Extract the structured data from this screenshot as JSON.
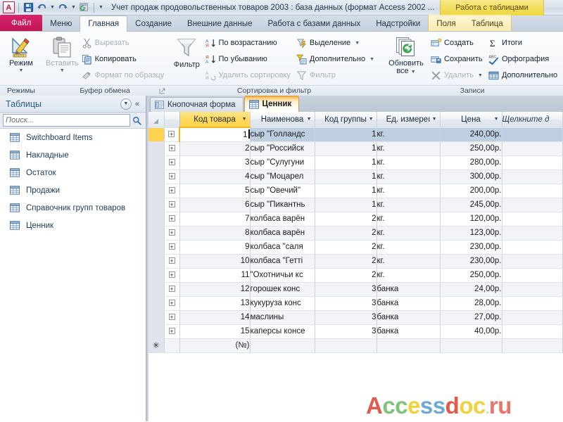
{
  "titlebar": {
    "app_logo": "A",
    "quick_access": [
      {
        "name": "save-icon",
        "label": "Сохранить"
      },
      {
        "name": "undo-icon",
        "label": "Отменить"
      },
      {
        "name": "redo-icon",
        "label": "Вернуть"
      },
      {
        "name": "refresh-all-icon",
        "label": "Обновить все"
      },
      {
        "name": "customize-qat-icon",
        "label": "Настройка панели быстрого доступа"
      }
    ],
    "document_title": "Учет продаж продовольственных товаров 2003 : база данных (формат Access 2002 ...",
    "context_tab_title": "Работа с таблицами"
  },
  "ribbon": {
    "file_tab": "Файл",
    "tabs": [
      {
        "label": "Меню",
        "active": false,
        "contextual": false
      },
      {
        "label": "Главная",
        "active": true,
        "contextual": false
      },
      {
        "label": "Создание",
        "active": false,
        "contextual": false
      },
      {
        "label": "Внешние данные",
        "active": false,
        "contextual": false
      },
      {
        "label": "Работа с базами данных",
        "active": false,
        "contextual": false
      },
      {
        "label": "Надстройки",
        "active": false,
        "contextual": false
      },
      {
        "label": "Поля",
        "active": false,
        "contextual": true
      },
      {
        "label": "Таблица",
        "active": false,
        "contextual": true
      }
    ],
    "groups": [
      {
        "title": "Режимы",
        "big": {
          "label": "Режим",
          "icon": "view-design-icon",
          "has_caret": true,
          "disabled": false
        }
      },
      {
        "title": "Буфер обмена",
        "has_dialog_launcher": true,
        "big": {
          "label": "Вставить",
          "icon": "paste-icon",
          "has_caret": true,
          "disabled": true
        },
        "small": [
          {
            "label": "Вырезать",
            "icon": "cut-icon",
            "disabled": true,
            "caret": false
          },
          {
            "label": "Копировать",
            "icon": "copy-icon",
            "disabled": false,
            "caret": false
          },
          {
            "label": "Формат по образцу",
            "icon": "format-painter-icon",
            "disabled": true,
            "caret": false
          }
        ]
      },
      {
        "title": "Сортировка и фильтр",
        "big": {
          "label": "Фильтр",
          "icon": "filter-icon",
          "has_caret": false,
          "disabled": false
        },
        "small": [
          {
            "label": "По возрастанию",
            "icon": "sort-asc-icon",
            "disabled": false,
            "caret": false
          },
          {
            "label": "По убыванию",
            "icon": "sort-desc-icon",
            "disabled": false,
            "caret": false
          },
          {
            "label": "Удалить сортировку",
            "icon": "clear-sort-icon",
            "disabled": true,
            "caret": false
          }
        ],
        "small2": [
          {
            "label": "Выделение",
            "icon": "selection-icon",
            "disabled": false,
            "caret": true
          },
          {
            "label": "Дополнительно",
            "icon": "advanced-filter-icon",
            "disabled": false,
            "caret": true
          },
          {
            "label": "Фильтр",
            "icon": "toggle-filter-icon",
            "disabled": true,
            "caret": false
          }
        ]
      },
      {
        "title": "Записи",
        "big": {
          "label": "Обновить\nвсе",
          "label_line1": "Обновить",
          "label_line2": "все",
          "icon": "refresh-all-big-icon",
          "has_caret": true,
          "disabled": false
        },
        "small": [
          {
            "label": "Создать",
            "icon": "new-record-icon",
            "disabled": false,
            "caret": false
          },
          {
            "label": "Сохранить",
            "icon": "save-record-icon",
            "disabled": false,
            "caret": false
          },
          {
            "label": "Удалить",
            "icon": "delete-record-icon",
            "disabled": true,
            "caret": true
          }
        ],
        "small2": [
          {
            "label": "Итоги",
            "icon": "totals-icon",
            "disabled": false,
            "caret": false
          },
          {
            "label": "Орфография",
            "icon": "spelling-icon",
            "disabled": false,
            "caret": false
          },
          {
            "label": "Дополнительно",
            "icon": "more-records-icon",
            "disabled": false,
            "caret": false
          }
        ]
      }
    ]
  },
  "navpane": {
    "title": "Таблицы",
    "search_placeholder": "Поиск...",
    "items": [
      {
        "label": "Switchboard Items",
        "icon": "table-icon"
      },
      {
        "label": "Накладные",
        "icon": "table-icon"
      },
      {
        "label": "Остаток",
        "icon": "table-icon"
      },
      {
        "label": "Продажи",
        "icon": "table-icon"
      },
      {
        "label": "Справочник групп товаров",
        "icon": "table-icon"
      },
      {
        "label": "Ценник",
        "icon": "table-icon"
      }
    ]
  },
  "document_tabs": [
    {
      "label": "Кнопочная форма",
      "icon": "form-icon",
      "active": false
    },
    {
      "label": "Ценник",
      "icon": "table-icon",
      "active": true
    }
  ],
  "datasheet": {
    "columns": [
      {
        "label": "Код товара",
        "align": "right",
        "selected": true
      },
      {
        "label": "Наименова",
        "align": "left",
        "selected": false
      },
      {
        "label": "Код группы",
        "align": "right",
        "selected": false
      },
      {
        "label": "Ед. измереı",
        "align": "left",
        "selected": false
      },
      {
        "label": "Цена",
        "align": "right",
        "selected": false
      }
    ],
    "add_new_column_label": "Щелкните д",
    "new_record_placeholder": "(№)",
    "rows": [
      {
        "code": "1",
        "name": "сыр \"Голландс",
        "group": "1",
        "unit": "кг.",
        "price": "240,00р."
      },
      {
        "code": "2",
        "name": "сыр \"Российск",
        "group": "1",
        "unit": "кг.",
        "price": "250,00р."
      },
      {
        "code": "3",
        "name": "сыр \"Сулугуни",
        "group": "1",
        "unit": "кг.",
        "price": "280,00р."
      },
      {
        "code": "4",
        "name": "сыр \"Моцарел",
        "group": "1",
        "unit": "кг.",
        "price": "300,00р."
      },
      {
        "code": "5",
        "name": "сыр \"Овечий\"",
        "group": "1",
        "unit": "кг.",
        "price": "200,00р."
      },
      {
        "code": "6",
        "name": "сыр \"Пикантнь",
        "group": "1",
        "unit": "кг.",
        "price": "245,00р."
      },
      {
        "code": "7",
        "name": "колбаса варён",
        "group": "2",
        "unit": "кг.",
        "price": "120,00р."
      },
      {
        "code": "8",
        "name": "колбаса варён",
        "group": "2",
        "unit": "кг.",
        "price": "123,00р."
      },
      {
        "code": "9",
        "name": "колбаса \"саля",
        "group": "2",
        "unit": "кг.",
        "price": "230,00р."
      },
      {
        "code": "10",
        "name": "колбаса \"Гетті",
        "group": "2",
        "unit": "кг.",
        "price": "230,00р."
      },
      {
        "code": "11",
        "name": "\"Охотничьи кс",
        "group": "2",
        "unit": "кг.",
        "price": "250,00р."
      },
      {
        "code": "12",
        "name": "горошек конс",
        "group": "3",
        "unit": "банка",
        "price": "24,00р."
      },
      {
        "code": "13",
        "name": "кукуруза конс",
        "group": "3",
        "unit": "банка",
        "price": "28,00р."
      },
      {
        "code": "14",
        "name": "маслины",
        "group": "3",
        "unit": "банка",
        "price": "27,00р."
      },
      {
        "code": "15",
        "name": "каперсы консе",
        "group": "3",
        "unit": "банка",
        "price": "40,00р."
      }
    ]
  },
  "watermark": {
    "letters": [
      {
        "ch": "A",
        "color": "#e05a4e"
      },
      {
        "ch": "c",
        "color": "#7cc47a"
      },
      {
        "ch": "c",
        "color": "#7cc47a"
      },
      {
        "ch": "e",
        "color": "#f2d23c"
      },
      {
        "ch": "s",
        "color": "#6aa9d8"
      },
      {
        "ch": "s",
        "color": "#6aa9d8"
      },
      {
        "ch": "d",
        "color": "#e05a4e"
      },
      {
        "ch": "o",
        "color": "#f2d23c"
      },
      {
        "ch": "c",
        "color": "#f2d23c"
      },
      {
        "ch": ".",
        "color": "#d8d8a0"
      },
      {
        "ch": "r",
        "color": "#e8746a"
      },
      {
        "ch": "u",
        "color": "#e8746a"
      }
    ],
    "text": "Accessdoc.ru"
  },
  "colors": {
    "accent_file_tab": "#c01557",
    "context_yellow": "#f3de5e",
    "active_doctab_orange": "#f8a832",
    "selected_row": "#bdcfe0",
    "selected_header": "#ffda5e"
  }
}
